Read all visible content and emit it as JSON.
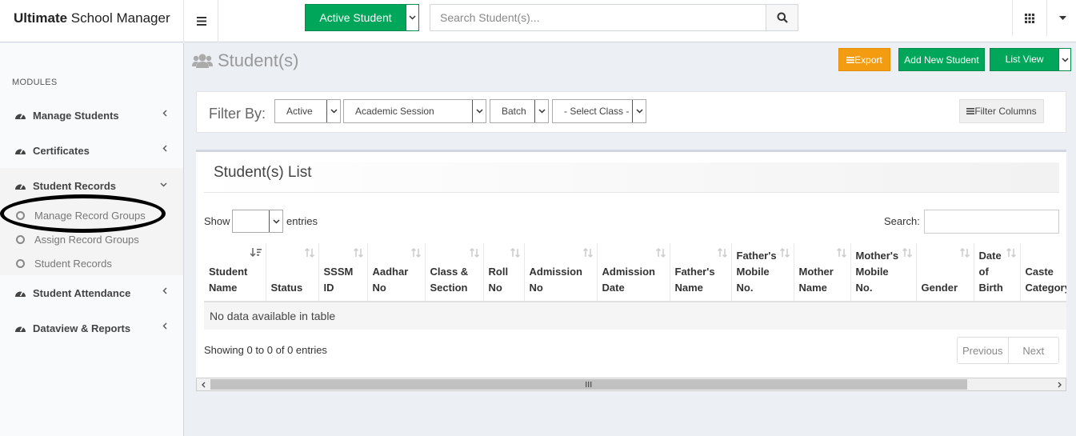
{
  "header": {
    "brand_bold": "Ultimate",
    "brand_rest": " School Manager",
    "active_student_label": "Active Student",
    "search_placeholder": "Search Student(s)..."
  },
  "sidebar": {
    "modules_label": "MODULES",
    "items": [
      {
        "label": "Manage Students",
        "icon": "dashboard-icon"
      },
      {
        "label": "Certificates",
        "icon": "dashboard-icon"
      },
      {
        "label": "Student Records",
        "icon": "dashboard-icon",
        "expanded": true
      },
      {
        "label": "Student Attendance",
        "icon": "dashboard-icon"
      },
      {
        "label": "Dataview & Reports",
        "icon": "dashboard-icon"
      }
    ],
    "sub_items": [
      {
        "label": "Manage Record Groups",
        "highlighted": true
      },
      {
        "label": "Assign Record Groups"
      },
      {
        "label": "Student Records"
      }
    ]
  },
  "page": {
    "title": "Student(s)",
    "export_label": "Export",
    "add_label": "Add New Student",
    "list_view_label": "List View"
  },
  "filter": {
    "label": "Filter By:",
    "status": "Active",
    "session": "Academic Session",
    "batch": "Batch",
    "class": "- Select Class -",
    "filter_columns_label": "Filter Columns"
  },
  "list": {
    "title": "Student(s) List",
    "show_label": "Show",
    "entries_label": "entries",
    "search_label": "Search:",
    "columns": [
      {
        "lines": [
          "Student",
          "Name"
        ],
        "w": 77
      },
      {
        "lines": [
          "Status"
        ],
        "w": 66
      },
      {
        "lines": [
          "SSSM",
          "ID"
        ],
        "w": 61
      },
      {
        "lines": [
          "Aadhar",
          "No"
        ],
        "w": 72
      },
      {
        "lines": [
          "Class &",
          "Section"
        ],
        "w": 73
      },
      {
        "lines": [
          "Roll",
          "No"
        ],
        "w": 51
      },
      {
        "lines": [
          "Admission",
          "No"
        ],
        "w": 91
      },
      {
        "lines": [
          "Admission",
          "Date"
        ],
        "w": 91
      },
      {
        "lines": [
          "Father's",
          "Name"
        ],
        "w": 77
      },
      {
        "lines": [
          "Father's",
          "Mobile",
          "No."
        ],
        "w": 78
      },
      {
        "lines": [
          "Mother",
          "Name"
        ],
        "w": 71
      },
      {
        "lines": [
          "Mother's",
          "Mobile",
          "No."
        ],
        "w": 82
      },
      {
        "lines": [
          "Gender"
        ],
        "w": 72
      },
      {
        "lines": [
          "Date",
          "of",
          "Birth"
        ],
        "w": 58
      },
      {
        "lines": [
          "Caste",
          "Category"
        ],
        "w": 80
      }
    ],
    "empty_message": "No data available in table",
    "showing_text": "Showing 0 to 0 of 0 entries",
    "prev_label": "Previous",
    "next_label": "Next"
  }
}
